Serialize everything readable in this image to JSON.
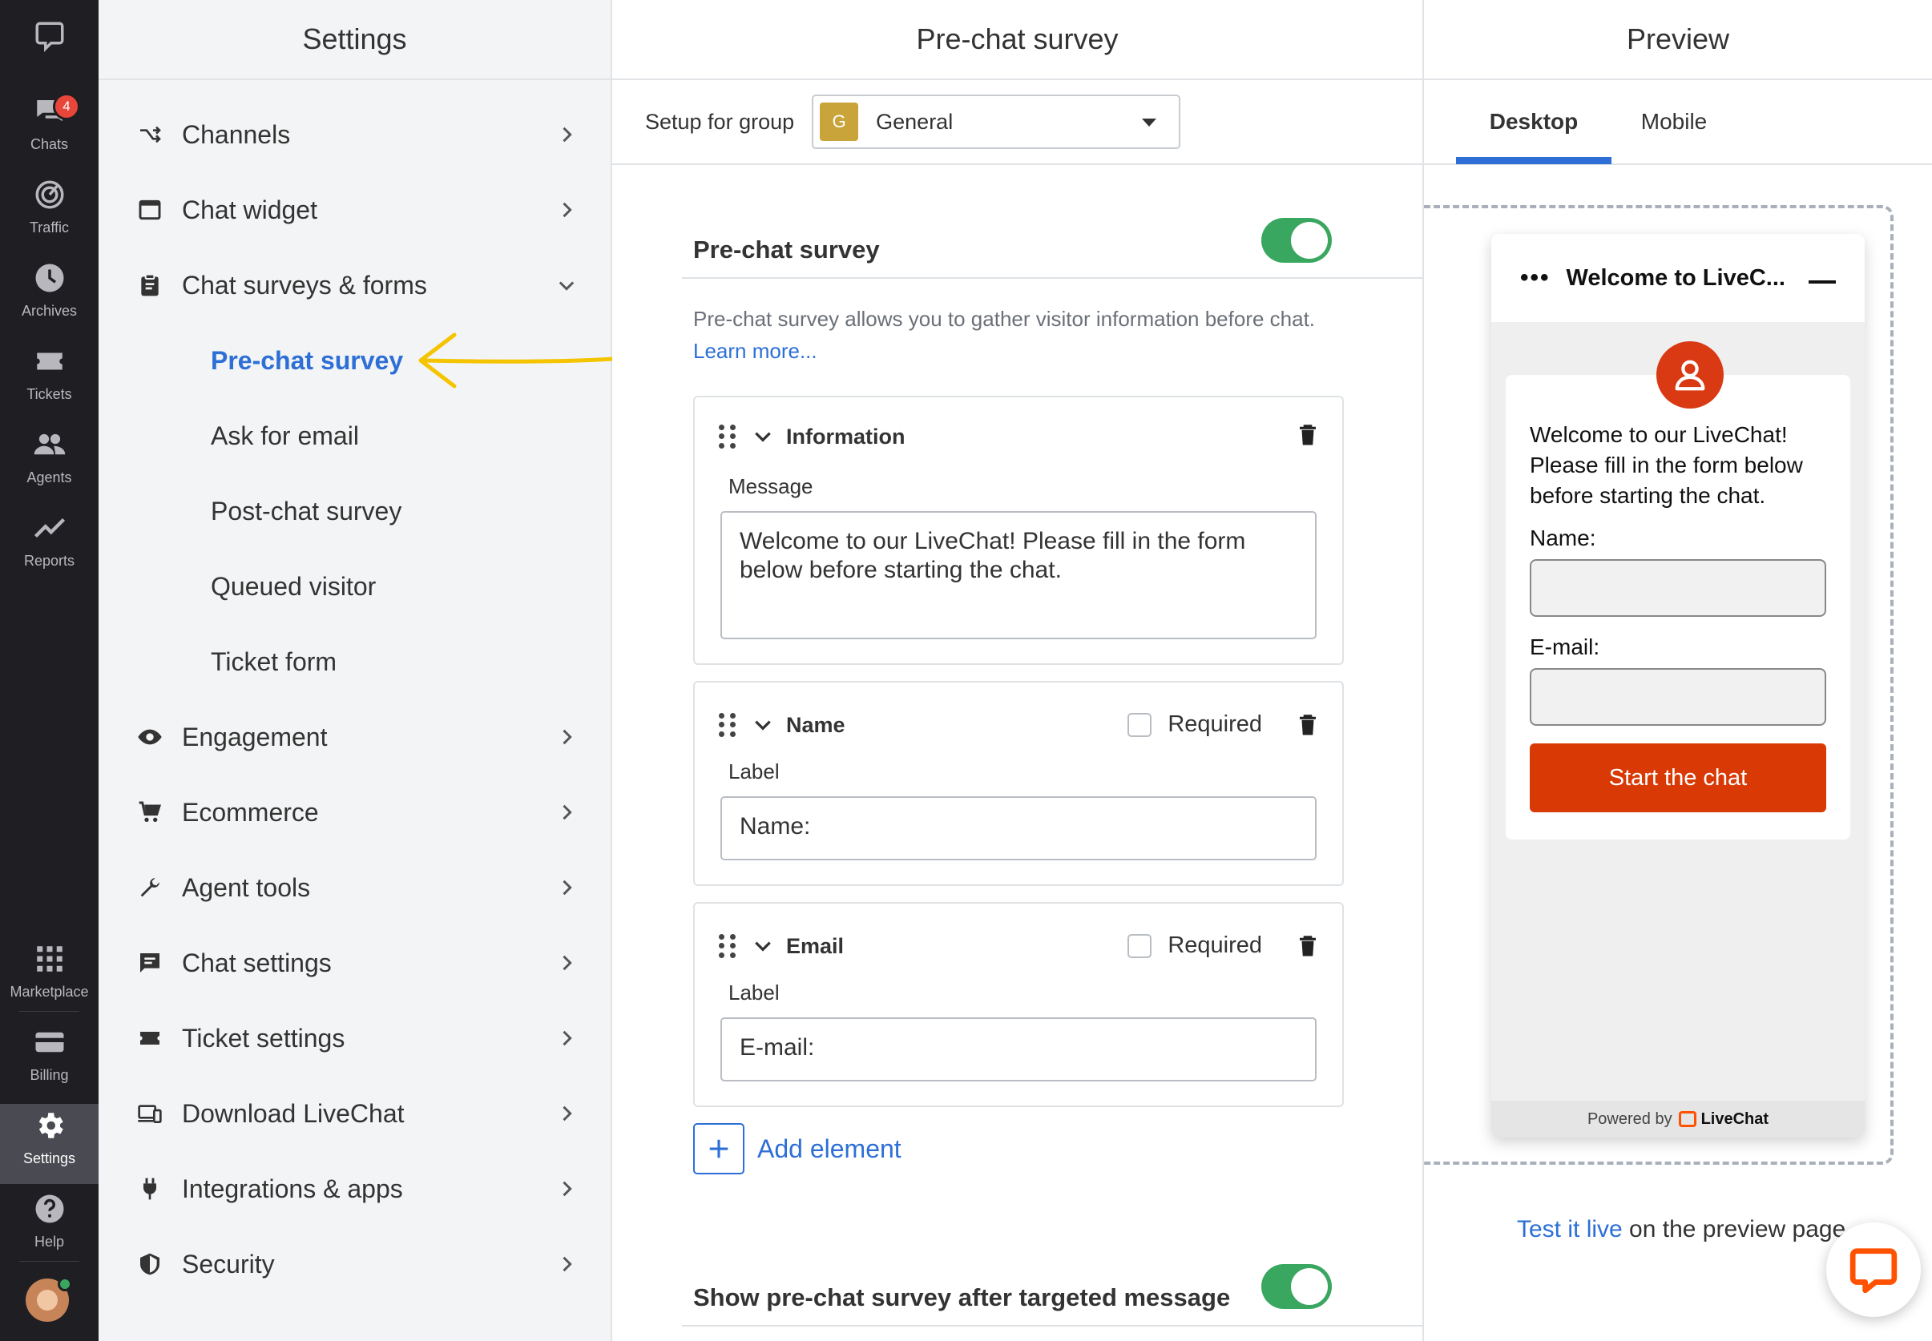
{
  "rail": {
    "items": [
      {
        "label": "Chats",
        "badge": "4"
      },
      {
        "label": "Traffic"
      },
      {
        "label": "Archives"
      },
      {
        "label": "Tickets"
      },
      {
        "label": "Agents"
      },
      {
        "label": "Reports"
      },
      {
        "label": "Marketplace"
      },
      {
        "label": "Billing"
      },
      {
        "label": "Settings"
      },
      {
        "label": "Help"
      }
    ]
  },
  "settings": {
    "title": "Settings",
    "nav": [
      {
        "label": "Channels"
      },
      {
        "label": "Chat widget"
      },
      {
        "label": "Chat surveys & forms"
      },
      {
        "label": "Engagement"
      },
      {
        "label": "Ecommerce"
      },
      {
        "label": "Agent tools"
      },
      {
        "label": "Chat settings"
      },
      {
        "label": "Ticket settings"
      },
      {
        "label": "Download LiveChat"
      },
      {
        "label": "Integrations & apps"
      },
      {
        "label": "Security"
      }
    ],
    "subnav": [
      {
        "label": "Pre-chat survey"
      },
      {
        "label": "Ask for email"
      },
      {
        "label": "Post-chat survey"
      },
      {
        "label": "Queued visitor"
      },
      {
        "label": "Ticket form"
      }
    ]
  },
  "main": {
    "title": "Pre-chat survey",
    "group_label": "Setup for group",
    "group_initial": "G",
    "group_value": "General",
    "section_title": "Pre-chat survey",
    "description": "Pre-chat survey allows you to gather visitor information before chat.",
    "learn_more": "Learn more...",
    "cards": [
      {
        "title": "Information",
        "field_label": "Message",
        "value": "Welcome to our LiveChat! Please fill in the form below before starting the chat."
      },
      {
        "title": "Name",
        "required_label": "Required",
        "field_label": "Label",
        "value": "Name:"
      },
      {
        "title": "Email",
        "required_label": "Required",
        "field_label": "Label",
        "value": "E-mail:"
      }
    ],
    "add_element": "Add element",
    "targeted_title": "Show pre-chat survey after targeted message"
  },
  "preview": {
    "title": "Preview",
    "tabs": [
      "Desktop",
      "Mobile"
    ],
    "widget": {
      "dots": "•••",
      "title": "Welcome to LiveC...",
      "message": "Welcome to our LiveChat! Please fill in the form below before starting the chat.",
      "name_label": "Name:",
      "email_label": "E-mail:",
      "button": "Start the chat",
      "powered_by": "Powered by",
      "brand": "LiveChat"
    },
    "test_link": "Test it live",
    "test_suffix": " on the preview page"
  },
  "colors": {
    "accent": "#2d6fd6",
    "toggle_on": "#3aa760",
    "brand_orange": "#d93a05",
    "rail_bg": "#1f1f23"
  }
}
